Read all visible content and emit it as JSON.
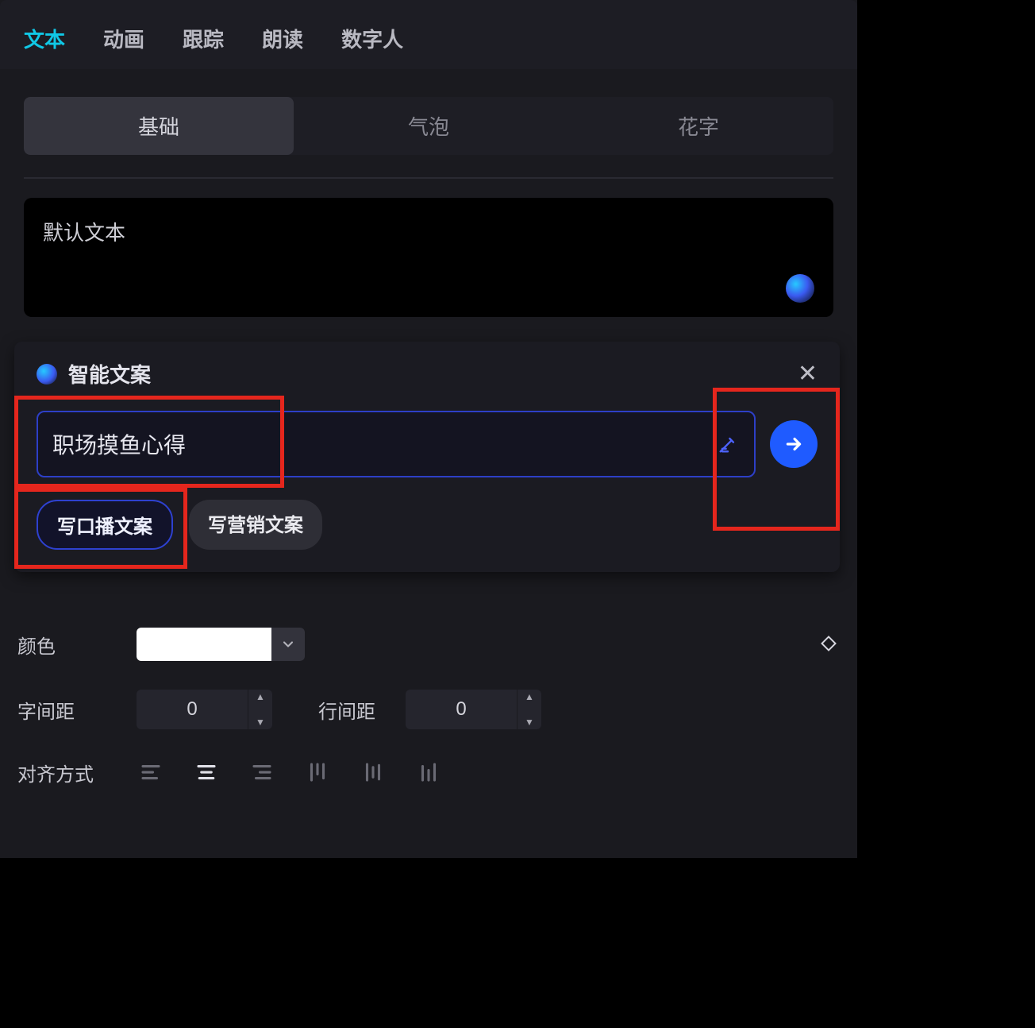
{
  "tabs": {
    "top": [
      "文本",
      "动画",
      "跟踪",
      "朗读",
      "数字人"
    ],
    "top_active_index": 0,
    "sub": [
      "基础",
      "气泡",
      "花字"
    ],
    "sub_active_index": 0
  },
  "text_area": {
    "default_text": "默认文本"
  },
  "ai_popup": {
    "title": "智能文案",
    "input_value": "职场摸鱼心得",
    "type_pills": [
      "写口播文案",
      "写营销文案"
    ],
    "type_active_index": 0
  },
  "settings": {
    "color_label": "颜色",
    "color_value": "#ffffff",
    "letter_spacing_label": "字间距",
    "letter_spacing_value": "0",
    "line_spacing_label": "行间距",
    "line_spacing_value": "0",
    "align_label": "对齐方式"
  }
}
